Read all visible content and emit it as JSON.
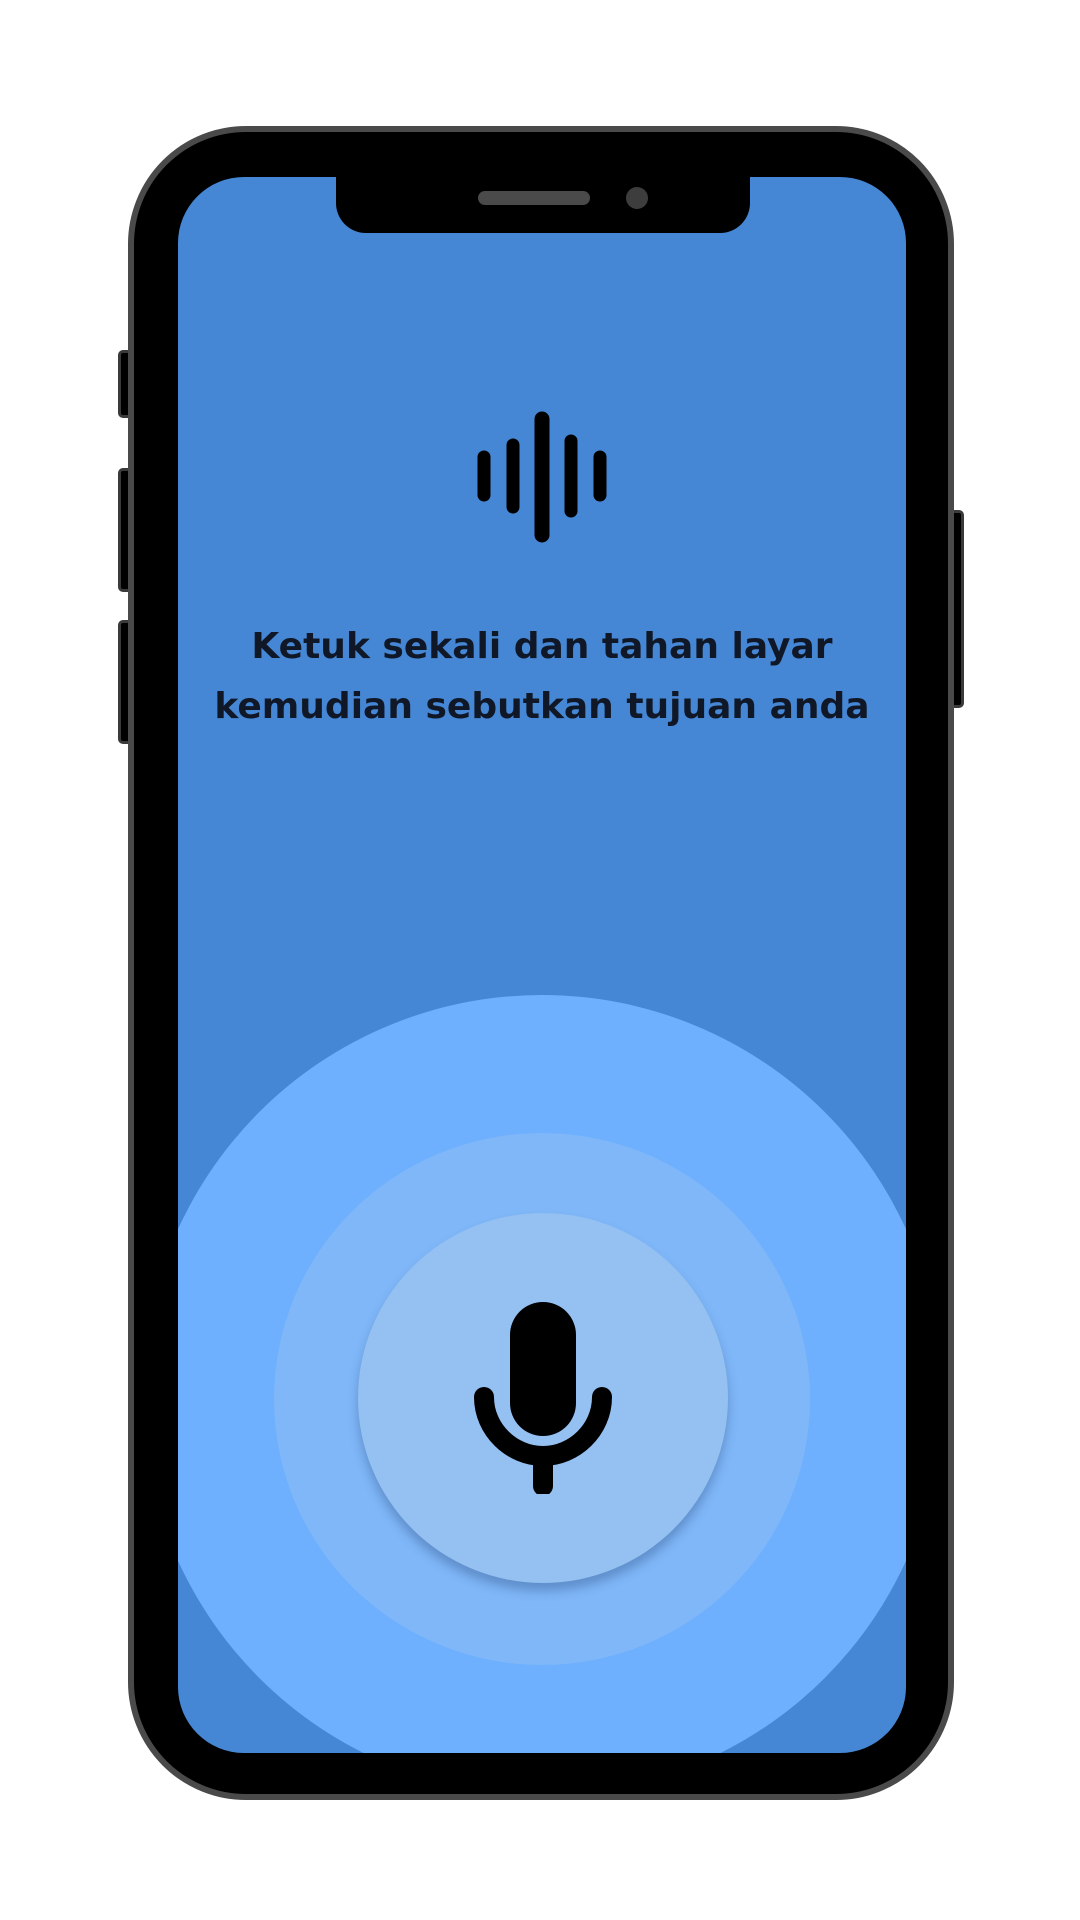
{
  "colors": {
    "screen_background": "#4587d4",
    "outer_ring": "#6eaffe",
    "middle_ring": "#7fb7f8",
    "mic_button": "#94c0f2",
    "text": "#101828",
    "device_frame": "#000000"
  },
  "icons": {
    "wave": "sound-wave-icon",
    "mic": "microphone-icon"
  },
  "instruction": {
    "line1": "Ketuk sekali dan tahan layar",
    "line2": "kemudian sebutkan tujuan anda"
  }
}
